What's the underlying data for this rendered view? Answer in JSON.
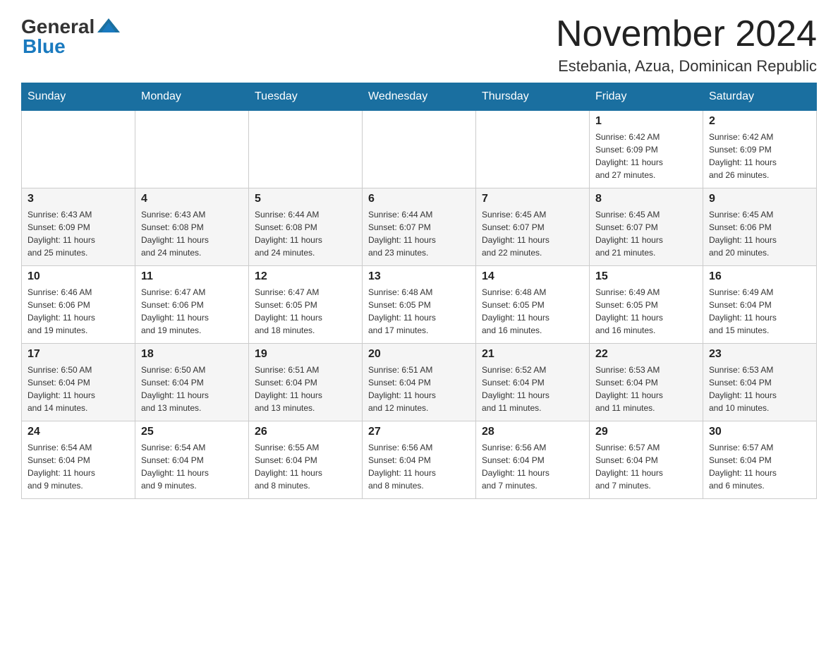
{
  "logo": {
    "general": "General",
    "blue": "Blue"
  },
  "title": "November 2024",
  "location": "Estebania, Azua, Dominican Republic",
  "weekdays": [
    "Sunday",
    "Monday",
    "Tuesday",
    "Wednesday",
    "Thursday",
    "Friday",
    "Saturday"
  ],
  "weeks": [
    [
      {
        "day": "",
        "info": ""
      },
      {
        "day": "",
        "info": ""
      },
      {
        "day": "",
        "info": ""
      },
      {
        "day": "",
        "info": ""
      },
      {
        "day": "",
        "info": ""
      },
      {
        "day": "1",
        "info": "Sunrise: 6:42 AM\nSunset: 6:09 PM\nDaylight: 11 hours\nand 27 minutes."
      },
      {
        "day": "2",
        "info": "Sunrise: 6:42 AM\nSunset: 6:09 PM\nDaylight: 11 hours\nand 26 minutes."
      }
    ],
    [
      {
        "day": "3",
        "info": "Sunrise: 6:43 AM\nSunset: 6:09 PM\nDaylight: 11 hours\nand 25 minutes."
      },
      {
        "day": "4",
        "info": "Sunrise: 6:43 AM\nSunset: 6:08 PM\nDaylight: 11 hours\nand 24 minutes."
      },
      {
        "day": "5",
        "info": "Sunrise: 6:44 AM\nSunset: 6:08 PM\nDaylight: 11 hours\nand 24 minutes."
      },
      {
        "day": "6",
        "info": "Sunrise: 6:44 AM\nSunset: 6:07 PM\nDaylight: 11 hours\nand 23 minutes."
      },
      {
        "day": "7",
        "info": "Sunrise: 6:45 AM\nSunset: 6:07 PM\nDaylight: 11 hours\nand 22 minutes."
      },
      {
        "day": "8",
        "info": "Sunrise: 6:45 AM\nSunset: 6:07 PM\nDaylight: 11 hours\nand 21 minutes."
      },
      {
        "day": "9",
        "info": "Sunrise: 6:45 AM\nSunset: 6:06 PM\nDaylight: 11 hours\nand 20 minutes."
      }
    ],
    [
      {
        "day": "10",
        "info": "Sunrise: 6:46 AM\nSunset: 6:06 PM\nDaylight: 11 hours\nand 19 minutes."
      },
      {
        "day": "11",
        "info": "Sunrise: 6:47 AM\nSunset: 6:06 PM\nDaylight: 11 hours\nand 19 minutes."
      },
      {
        "day": "12",
        "info": "Sunrise: 6:47 AM\nSunset: 6:05 PM\nDaylight: 11 hours\nand 18 minutes."
      },
      {
        "day": "13",
        "info": "Sunrise: 6:48 AM\nSunset: 6:05 PM\nDaylight: 11 hours\nand 17 minutes."
      },
      {
        "day": "14",
        "info": "Sunrise: 6:48 AM\nSunset: 6:05 PM\nDaylight: 11 hours\nand 16 minutes."
      },
      {
        "day": "15",
        "info": "Sunrise: 6:49 AM\nSunset: 6:05 PM\nDaylight: 11 hours\nand 16 minutes."
      },
      {
        "day": "16",
        "info": "Sunrise: 6:49 AM\nSunset: 6:04 PM\nDaylight: 11 hours\nand 15 minutes."
      }
    ],
    [
      {
        "day": "17",
        "info": "Sunrise: 6:50 AM\nSunset: 6:04 PM\nDaylight: 11 hours\nand 14 minutes."
      },
      {
        "day": "18",
        "info": "Sunrise: 6:50 AM\nSunset: 6:04 PM\nDaylight: 11 hours\nand 13 minutes."
      },
      {
        "day": "19",
        "info": "Sunrise: 6:51 AM\nSunset: 6:04 PM\nDaylight: 11 hours\nand 13 minutes."
      },
      {
        "day": "20",
        "info": "Sunrise: 6:51 AM\nSunset: 6:04 PM\nDaylight: 11 hours\nand 12 minutes."
      },
      {
        "day": "21",
        "info": "Sunrise: 6:52 AM\nSunset: 6:04 PM\nDaylight: 11 hours\nand 11 minutes."
      },
      {
        "day": "22",
        "info": "Sunrise: 6:53 AM\nSunset: 6:04 PM\nDaylight: 11 hours\nand 11 minutes."
      },
      {
        "day": "23",
        "info": "Sunrise: 6:53 AM\nSunset: 6:04 PM\nDaylight: 11 hours\nand 10 minutes."
      }
    ],
    [
      {
        "day": "24",
        "info": "Sunrise: 6:54 AM\nSunset: 6:04 PM\nDaylight: 11 hours\nand 9 minutes."
      },
      {
        "day": "25",
        "info": "Sunrise: 6:54 AM\nSunset: 6:04 PM\nDaylight: 11 hours\nand 9 minutes."
      },
      {
        "day": "26",
        "info": "Sunrise: 6:55 AM\nSunset: 6:04 PM\nDaylight: 11 hours\nand 8 minutes."
      },
      {
        "day": "27",
        "info": "Sunrise: 6:56 AM\nSunset: 6:04 PM\nDaylight: 11 hours\nand 8 minutes."
      },
      {
        "day": "28",
        "info": "Sunrise: 6:56 AM\nSunset: 6:04 PM\nDaylight: 11 hours\nand 7 minutes."
      },
      {
        "day": "29",
        "info": "Sunrise: 6:57 AM\nSunset: 6:04 PM\nDaylight: 11 hours\nand 7 minutes."
      },
      {
        "day": "30",
        "info": "Sunrise: 6:57 AM\nSunset: 6:04 PM\nDaylight: 11 hours\nand 6 minutes."
      }
    ]
  ]
}
